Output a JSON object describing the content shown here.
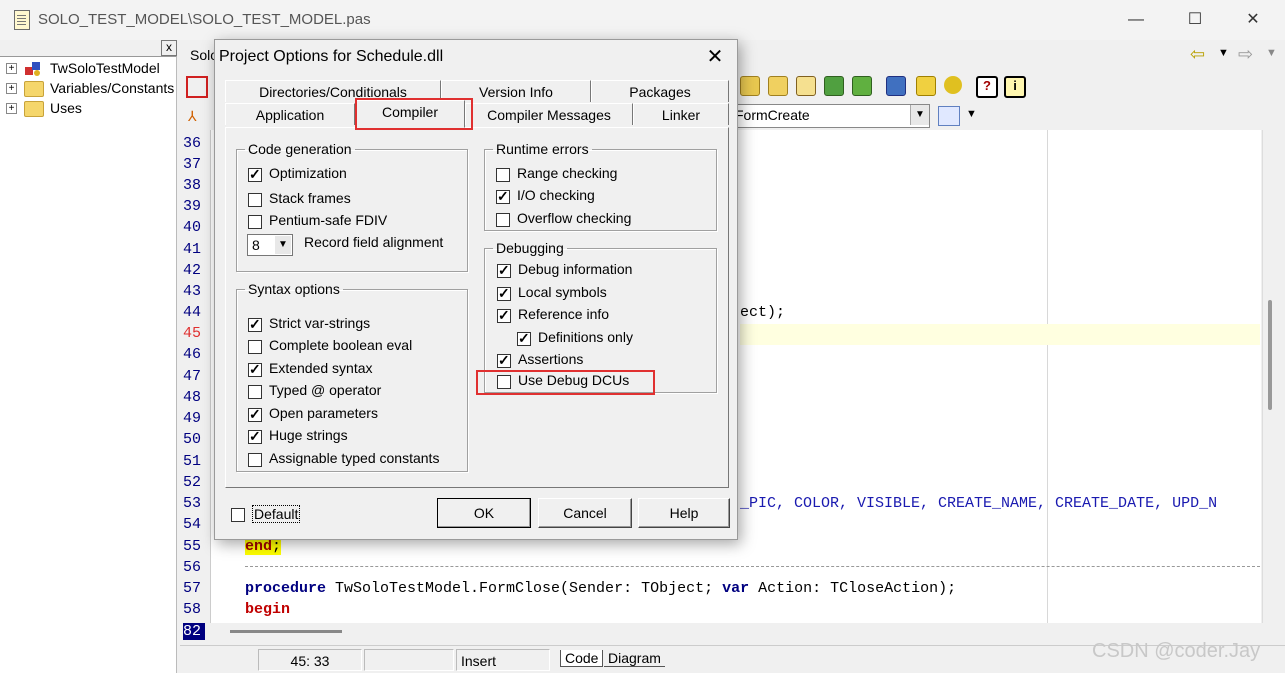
{
  "window": {
    "title": "SOLO_TEST_MODEL\\SOLO_TEST_MODEL.pas",
    "minimize": "—",
    "maximize": "☐",
    "close": "✕"
  },
  "tree": {
    "close": "x",
    "items": [
      {
        "label": "TwSoloTestModel",
        "icon": "unit-icon"
      },
      {
        "label": "Variables/Constants",
        "icon": "folder-icon"
      },
      {
        "label": "Uses",
        "icon": "folder-icon"
      }
    ]
  },
  "editor_tab": {
    "label": "Solo"
  },
  "method_combo": {
    "value": "FormCreate"
  },
  "editor": {
    "line_numbers": [
      "36",
      "37",
      "38",
      "39",
      "40",
      "41",
      "42",
      "43",
      "44",
      "45",
      "46",
      "47",
      "48",
      "49",
      "50",
      "51",
      "52",
      "53",
      "54",
      "55",
      "56",
      "57",
      "58",
      "82"
    ],
    "current_line": "45",
    "visible_code": [
      {
        "line": "44",
        "text": "ect);"
      },
      {
        "line": "53",
        "text": "_PIC, COLOR, VISIBLE, CREATE_NAME, CREATE_DATE, UPD_N"
      },
      {
        "line": "55",
        "keyword": "end",
        "text": ";"
      },
      {
        "line": "57",
        "keyword": "procedure",
        "text": " TwSoloTestModel.FormClose(Sender: TObject; ",
        "keyword2": "var",
        "text2": " Action: TCloseAction);"
      },
      {
        "line": "58",
        "keyword": "begin",
        "text": ""
      }
    ]
  },
  "status": {
    "position": "45: 33",
    "mode": "Insert",
    "tab_code": "Code",
    "tab_diagram": "Diagram"
  },
  "dialog": {
    "title": "Project Options for Schedule.dll",
    "close": "✕",
    "tabs_row1": [
      "Directories/Conditionals",
      "Version Info",
      "Packages"
    ],
    "tabs_row2": [
      "Application",
      "Compiler",
      "Compiler Messages",
      "Linker"
    ],
    "active_tab": "Compiler",
    "code_generation": {
      "legend": "Code generation",
      "optimization": {
        "label": "Optimization",
        "checked": true
      },
      "stack_frames": {
        "label": "Stack frames",
        "checked": false
      },
      "pentium_fdiv": {
        "label": "Pentium-safe FDIV",
        "checked": false
      },
      "record_alignment": {
        "value": "8",
        "label": "Record field alignment"
      }
    },
    "syntax_options": {
      "legend": "Syntax options",
      "items": [
        {
          "label": "Strict var-strings",
          "checked": true
        },
        {
          "label": "Complete boolean eval",
          "checked": false
        },
        {
          "label": "Extended syntax",
          "checked": true
        },
        {
          "label": "Typed @ operator",
          "checked": false
        },
        {
          "label": "Open parameters",
          "checked": true
        },
        {
          "label": "Huge strings",
          "checked": true
        },
        {
          "label": "Assignable typed constants",
          "checked": false
        }
      ]
    },
    "runtime_errors": {
      "legend": "Runtime errors",
      "items": [
        {
          "label": "Range checking",
          "checked": false
        },
        {
          "label": "I/O checking",
          "checked": true
        },
        {
          "label": "Overflow checking",
          "checked": false
        }
      ]
    },
    "debugging": {
      "legend": "Debugging",
      "items": [
        {
          "label": "Debug information",
          "checked": true
        },
        {
          "label": "Local symbols",
          "checked": true
        },
        {
          "label": "Reference info",
          "checked": true
        },
        {
          "label": "Definitions only",
          "checked": true
        },
        {
          "label": "Assertions",
          "checked": true
        },
        {
          "label": "Use Debug DCUs",
          "checked": false
        }
      ]
    },
    "default": {
      "label": "Default",
      "checked": false
    },
    "buttons": {
      "ok": "OK",
      "cancel": "Cancel",
      "help": "Help"
    }
  },
  "watermark": "CSDN @coder.Jay"
}
